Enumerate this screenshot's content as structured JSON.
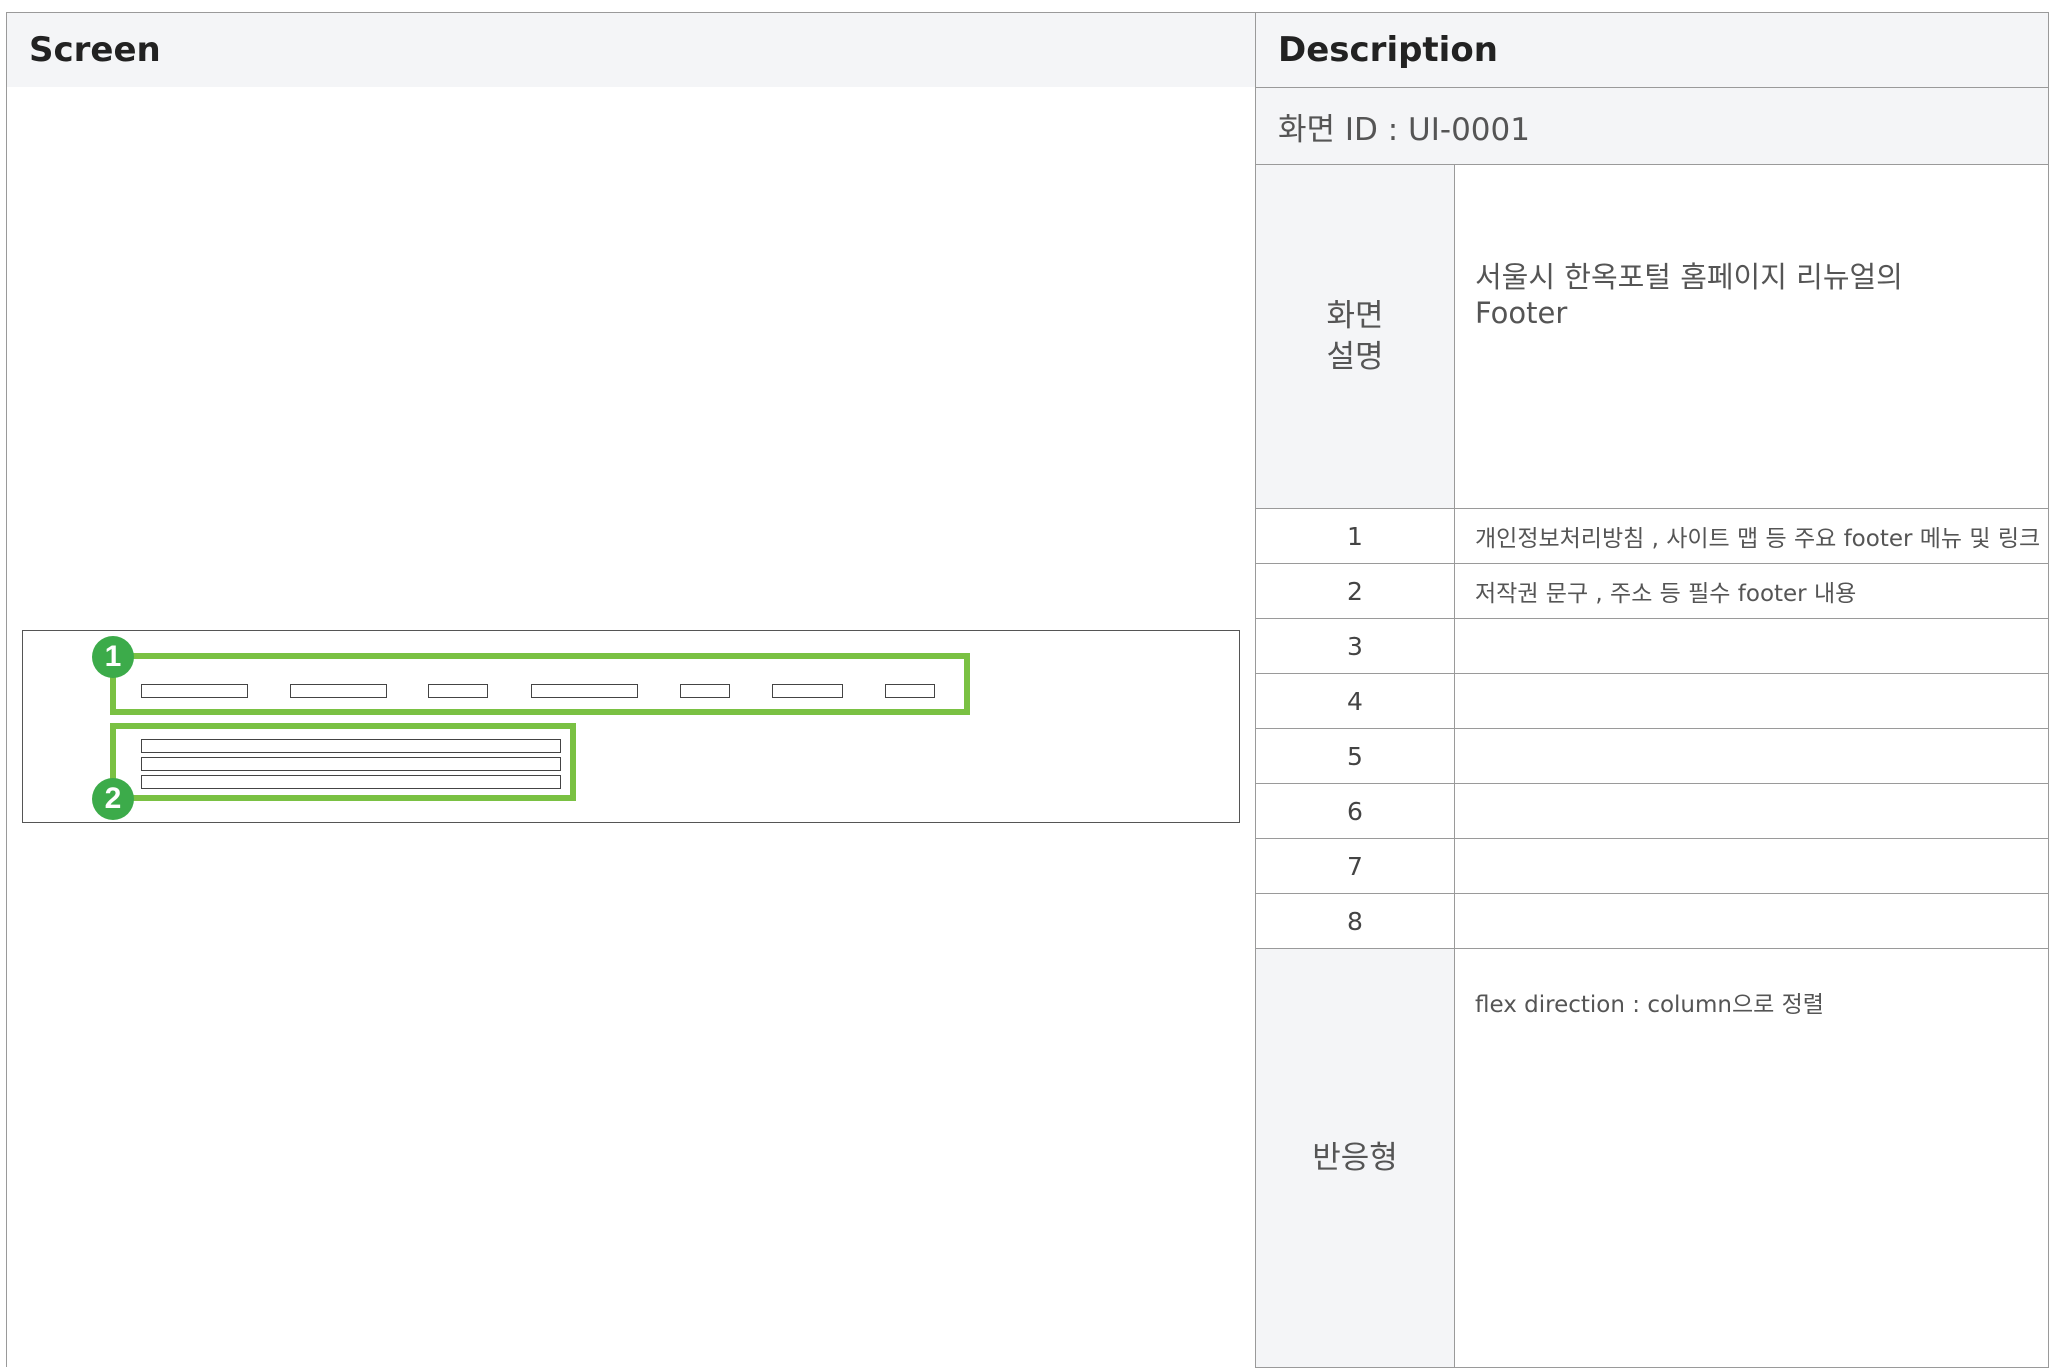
{
  "headers": {
    "screen": "Screen",
    "description": "Description"
  },
  "screen_id": "화면 ID : UI-0001",
  "screen_desc": {
    "label_line1": "화면",
    "label_line2": "설명",
    "text_line1": "서울시 한옥포털 홈페이지 리뉴얼의",
    "text_line2": "Footer"
  },
  "items": [
    {
      "num": "1",
      "text": "개인정보처리방침 , 사이트 맵 등 주요 footer 메뉴 및 링크"
    },
    {
      "num": "2",
      "text": "저작권 문구 , 주소 등 필수 footer 내용"
    },
    {
      "num": "3",
      "text": ""
    },
    {
      "num": "4",
      "text": ""
    },
    {
      "num": "5",
      "text": ""
    },
    {
      "num": "6",
      "text": ""
    },
    {
      "num": "7",
      "text": ""
    },
    {
      "num": "8",
      "text": ""
    }
  ],
  "responsive": {
    "label": "반응형",
    "text": "flex direction : column으로 정렬"
  },
  "wireframe": {
    "badge1": "1",
    "badge2": "2",
    "accent_color": "#7ac143",
    "badge_color": "#3cab4a"
  }
}
